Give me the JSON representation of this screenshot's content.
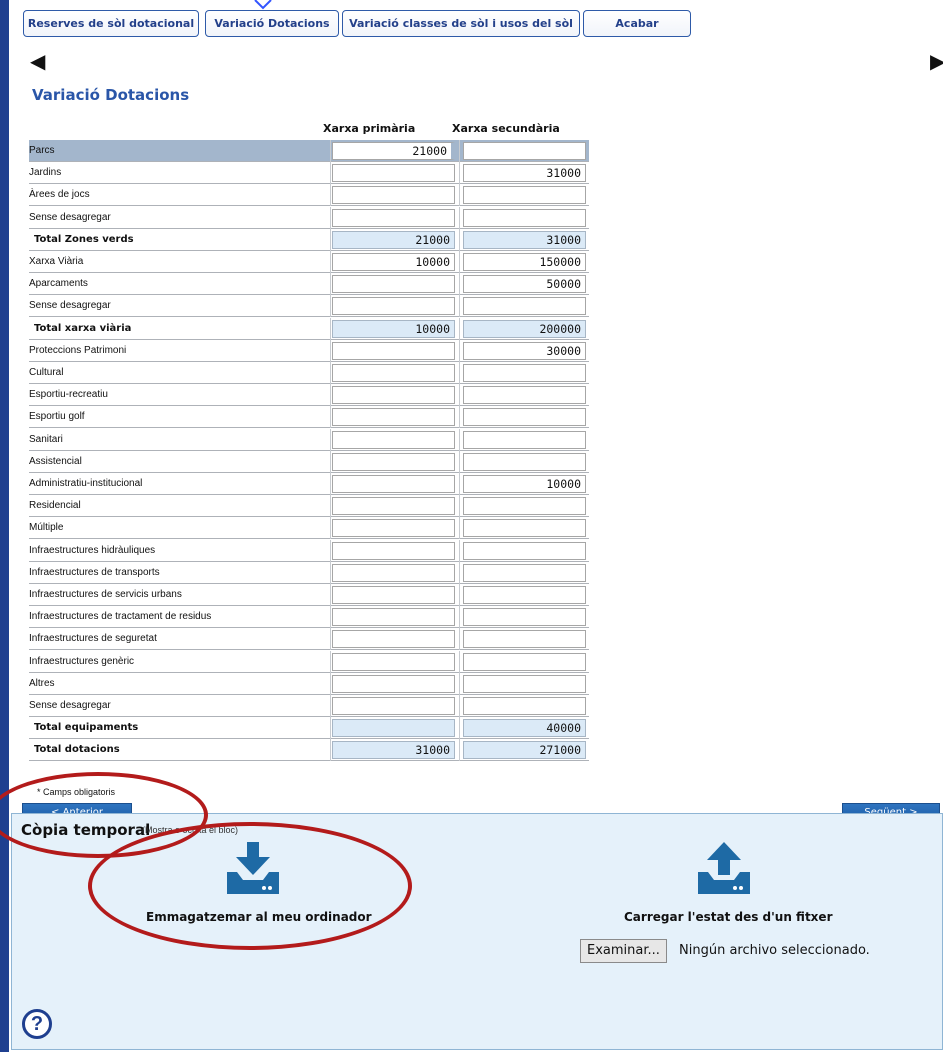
{
  "tabs": [
    {
      "label": "Reserves de sòl dotacional"
    },
    {
      "label": "Variació Dotacions"
    },
    {
      "label": "Variació classes de sòl i usos del sòl"
    },
    {
      "label": "Acabar"
    }
  ],
  "nav_arrows": {
    "left": "◀",
    "right": "▶"
  },
  "page_title": "Variació Dotacions",
  "table": {
    "col_primary": "Xarxa primària",
    "col_secondary": "Xarxa secundària",
    "rows": [
      {
        "label": "Parcs",
        "primary": "21000",
        "secondary": ""
      },
      {
        "label": "Jardins",
        "primary": "",
        "secondary": "31000"
      },
      {
        "label": "Àrees de jocs",
        "primary": "",
        "secondary": ""
      },
      {
        "label": "Sense desagregar",
        "primary": "",
        "secondary": ""
      },
      {
        "label": "Total Zones verds",
        "primary": "21000",
        "secondary": "31000"
      },
      {
        "label": "Xarxa Viària",
        "primary": "10000",
        "secondary": "150000"
      },
      {
        "label": "Aparcaments",
        "primary": "",
        "secondary": "50000"
      },
      {
        "label": "Sense desagregar",
        "primary": "",
        "secondary": ""
      },
      {
        "label": "Total xarxa viària",
        "primary": "10000",
        "secondary": "200000"
      },
      {
        "label": "Proteccions Patrimoni",
        "primary": "",
        "secondary": "30000"
      },
      {
        "label": "Cultural",
        "primary": "",
        "secondary": ""
      },
      {
        "label": "Esportiu-recreatiu",
        "primary": "",
        "secondary": ""
      },
      {
        "label": "Esportiu golf",
        "primary": "",
        "secondary": ""
      },
      {
        "label": "Sanitari",
        "primary": "",
        "secondary": ""
      },
      {
        "label": "Assistencial",
        "primary": "",
        "secondary": ""
      },
      {
        "label": "Administratiu-institucional",
        "primary": "",
        "secondary": "10000"
      },
      {
        "label": "Residencial",
        "primary": "",
        "secondary": ""
      },
      {
        "label": "Múltiple",
        "primary": "",
        "secondary": ""
      },
      {
        "label": "Infraestructures hidràuliques",
        "primary": "",
        "secondary": ""
      },
      {
        "label": "Infraestructures de transports",
        "primary": "",
        "secondary": ""
      },
      {
        "label": "Infraestructures de servicis urbans",
        "primary": "",
        "secondary": ""
      },
      {
        "label": "Infraestructures de tractament de residus",
        "primary": "",
        "secondary": ""
      },
      {
        "label": "Infraestructures de seguretat",
        "primary": "",
        "secondary": ""
      },
      {
        "label": "Infraestructures genèric",
        "primary": "",
        "secondary": ""
      },
      {
        "label": "Altres",
        "primary": "",
        "secondary": ""
      },
      {
        "label": "Sense desagregar",
        "primary": "",
        "secondary": ""
      },
      {
        "label": "Total equipaments",
        "primary": "",
        "secondary": "40000"
      },
      {
        "label": "Total dotacions",
        "primary": "31000",
        "secondary": "271000"
      }
    ]
  },
  "required_note": "* Camps obligatoris",
  "buttons": {
    "previous": "< Anterior",
    "next": "Següent >"
  },
  "backup": {
    "title": "Còpia temporal",
    "hint": "(Mostra o oculta el bloc)",
    "save_label": "Emmagatzemar al meu ordinador",
    "load_label": "Carregar l'estat des d'un fitxer",
    "browse_label": "Examinar...",
    "no_file": "Ningún archivo seleccionado.",
    "help_glyph": "?"
  },
  "colors": {
    "accent": "#2a56a8",
    "button": "#1d5ea9",
    "annotation": "#b31b1b",
    "icon": "#1e6aa5"
  }
}
